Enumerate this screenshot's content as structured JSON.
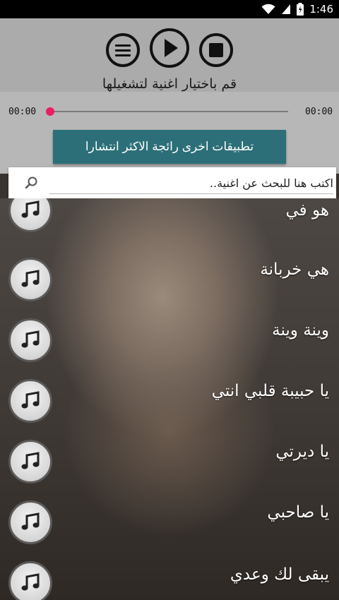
{
  "status_bar": {
    "time": "1:46"
  },
  "player": {
    "hint": "قم باختيار اغنية لتشغيلها",
    "time_start": "00:00",
    "time_end": "00:00",
    "progress": 0
  },
  "promo_label": "تطبيقات اخرى رائجة الاكثر انتشارا",
  "search": {
    "placeholder": "اكتب هنا للبحث عن اغنية.."
  },
  "songs": [
    {
      "title": "هو في"
    },
    {
      "title": "هي خربانة"
    },
    {
      "title": "وينة وينة"
    },
    {
      "title": "يا حبيبة قلبي انتي"
    },
    {
      "title": "يا ديرتي"
    },
    {
      "title": "يا صاحبي"
    },
    {
      "title": "يبقى لك وعدي"
    }
  ],
  "colors": {
    "accent": "#e91e63",
    "promo": "#2c6f78",
    "player_bg": "#ababab"
  }
}
